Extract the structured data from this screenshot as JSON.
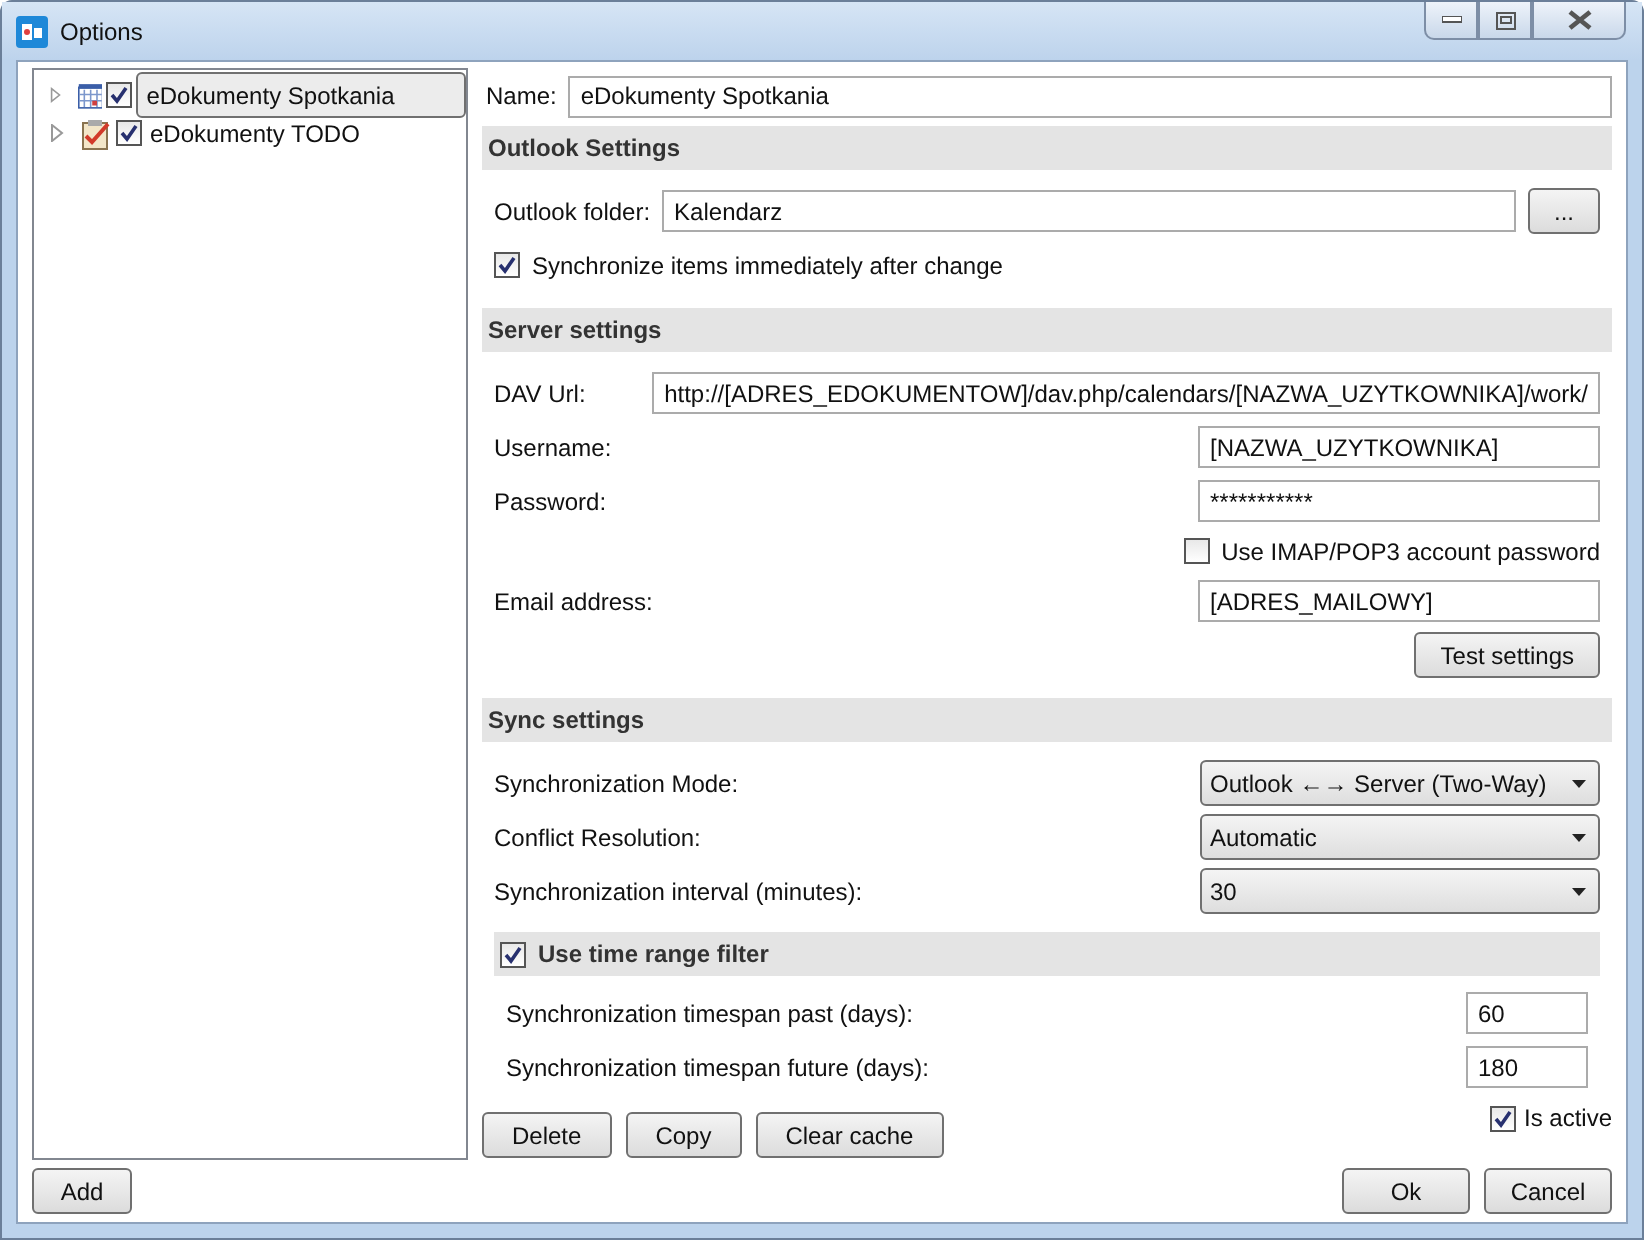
{
  "window": {
    "title": "Options"
  },
  "tree": {
    "items": [
      {
        "label": "eDokumenty Spotkania",
        "kind": "calendar",
        "checked": true,
        "selected": true,
        "expanded": false
      },
      {
        "label": "eDokumenty TODO",
        "kind": "task",
        "checked": true,
        "selected": false,
        "expanded": false
      }
    ]
  },
  "name": {
    "label": "Name:",
    "value": "eDokumenty Spotkania"
  },
  "sections": [
    {
      "title": "Outlook Settings",
      "kind": "header",
      "rows": [
        {
          "kind": "browse-field",
          "label": "Outlook folder:",
          "value": "Kalendarz",
          "button": "..."
        },
        {
          "kind": "checkbox",
          "label": "Synchronize items immediately after change",
          "checked": true
        }
      ]
    },
    {
      "title": "Server settings",
      "kind": "header",
      "rows": [
        {
          "kind": "wide-field",
          "label": "DAV Url:",
          "value": "http://[ADRES_EDOKUMENTOW]/dav.php/calendars/[NAZWA_UZYTKOWNIKA]/work/"
        },
        {
          "kind": "field",
          "label": "Username:",
          "value": "[NAZWA_UZYTKOWNIKA]"
        },
        {
          "kind": "field",
          "label": "Password:",
          "value": "***********"
        },
        {
          "kind": "checkbox-right",
          "label": "Use IMAP/POP3 account password",
          "checked": false
        },
        {
          "kind": "field",
          "label": "Email address:",
          "value": "[ADRES_MAILOWY]"
        },
        {
          "kind": "button-right",
          "label": "Test settings"
        }
      ]
    },
    {
      "title": "Sync settings",
      "kind": "header",
      "rows": [
        {
          "kind": "select",
          "label": "Synchronization Mode:",
          "value": "Outlook ←→ Server (Two-Way)"
        },
        {
          "kind": "select",
          "label": "Conflict Resolution:",
          "value": "Automatic"
        },
        {
          "kind": "select",
          "label": "Synchronization interval (minutes):",
          "value": "30"
        }
      ]
    },
    {
      "title": "Use time range filter",
      "kind": "checkbox-header",
      "checked": true,
      "rows": [
        {
          "kind": "number",
          "label": "Synchronization timespan past (days):",
          "value": "60"
        },
        {
          "kind": "number",
          "label": "Synchronization timespan future (days):",
          "value": "180"
        }
      ]
    }
  ],
  "actions": [
    "Delete",
    "Copy",
    "Clear cache"
  ],
  "active": {
    "label": "Is active",
    "checked": true
  },
  "footer": {
    "left": [
      "Add"
    ],
    "right": [
      "Ok",
      "Cancel"
    ]
  }
}
